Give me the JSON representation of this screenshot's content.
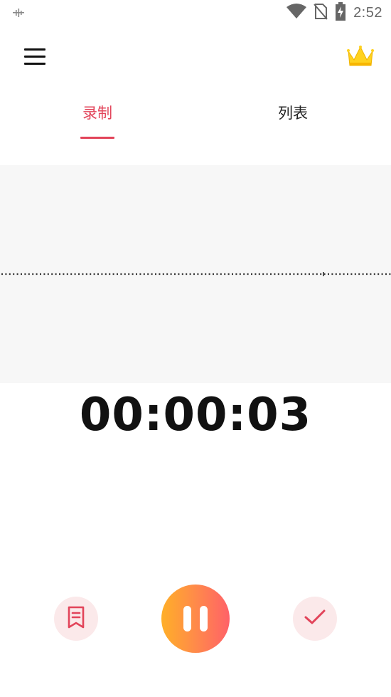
{
  "status_bar": {
    "time": "2:52",
    "icons": [
      "signal-notification-icon",
      "wifi-icon",
      "no-sim-icon",
      "battery-charging-icon"
    ]
  },
  "app_bar": {
    "menu_icon": "hamburger-menu-icon",
    "premium_icon": "crown-icon"
  },
  "tabs": [
    {
      "label": "录制",
      "active": true
    },
    {
      "label": "列表",
      "active": false
    }
  ],
  "recorder": {
    "timer": "00:00:03"
  },
  "controls": {
    "mark_icon": "bookmark-icon",
    "pause_icon": "pause-icon",
    "done_icon": "checkmark-icon"
  },
  "colors": {
    "accent": "#e2445a",
    "pause_gradient_start": "#ffaf28",
    "pause_gradient_end": "#ff6168",
    "side_button_bg": "#fbe9ea",
    "wave_panel_bg": "#f7f7f7"
  }
}
